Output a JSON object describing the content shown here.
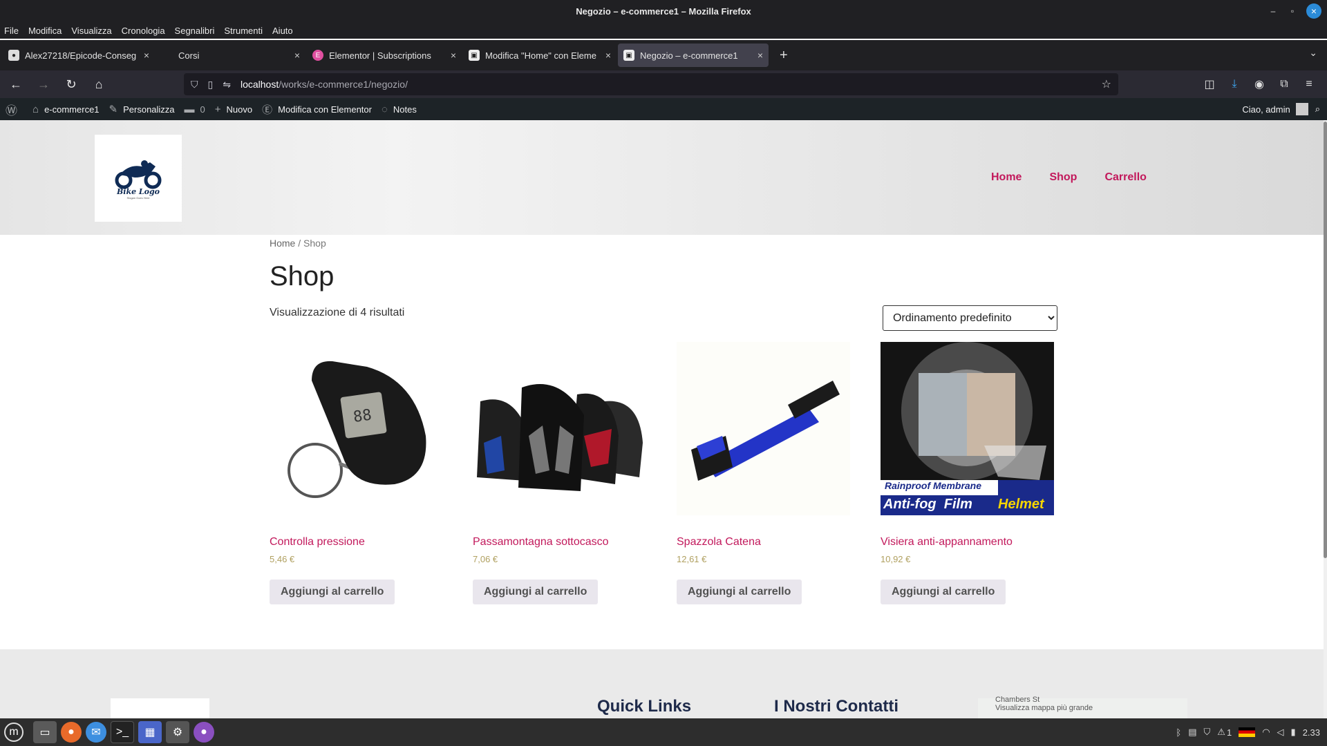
{
  "window": {
    "title": "Negozio – e-commerce1 – Mozilla Firefox"
  },
  "menu": [
    "File",
    "Modifica",
    "Visualizza",
    "Cronologia",
    "Segnalibri",
    "Strumenti",
    "Aiuto"
  ],
  "tabs": [
    {
      "label": "Alex27218/Epicode-Conseg",
      "icon": "github-icon",
      "active": false
    },
    {
      "label": "Corsi",
      "icon": "page-icon",
      "active": false
    },
    {
      "label": "Elementor | Subscriptions",
      "icon": "elementor-icon",
      "active": false
    },
    {
      "label": "Modifica \"Home\" con Eleme",
      "icon": "page-icon",
      "active": false
    },
    {
      "label": "Negozio – e-commerce1",
      "icon": "page-icon",
      "active": true
    }
  ],
  "url": {
    "host": "localhost",
    "path": "/works/e-commerce1/negozio/"
  },
  "wpbar": {
    "site": "e-commerce1",
    "customize": "Personalizza",
    "comments": "0",
    "new": "Nuovo",
    "elementor": "Modifica con Elementor",
    "notes": "Notes",
    "greeting": "Ciao, admin"
  },
  "site": {
    "logo_text": "Bike Logo",
    "logo_sub": "Slogan Goes Here",
    "nav": [
      "Home",
      "Shop",
      "Carrello"
    ]
  },
  "breadcrumb": {
    "home": "Home",
    "sep": " / ",
    "current": "Shop"
  },
  "shop": {
    "title": "Shop",
    "results": "Visualizzazione di 4 risultati",
    "sort": "Ordinamento predefinito",
    "products": [
      {
        "name": "Controlla pressione",
        "price": "5,46 €",
        "button": "Aggiungi al carrello"
      },
      {
        "name": "Passamontagna sottocasco",
        "price": "7,06 €",
        "button": "Aggiungi al carrello"
      },
      {
        "name": "Spazzola Catena",
        "price": "12,61 €",
        "button": "Aggiungi al carrello"
      },
      {
        "name": "Visiera anti-appannamento",
        "price": "10,92 €",
        "button": "Aggiungi al carrello"
      }
    ],
    "helmet_text": {
      "line1": "Rainproof Membrane",
      "line2a": "Anti-fog  Film",
      "line2b": "Helmet"
    }
  },
  "footer": {
    "quick_links": "Quick Links",
    "contacts": "I Nostri Contatti",
    "map_street": "Chambers St",
    "map_link": "Visualizza mappa più grande"
  },
  "taskbar": {
    "time": "2.33",
    "notif": "1"
  },
  "colors": {
    "accent": "#c2185b",
    "price": "#b0a060",
    "wp_bar": "#1d2327"
  }
}
